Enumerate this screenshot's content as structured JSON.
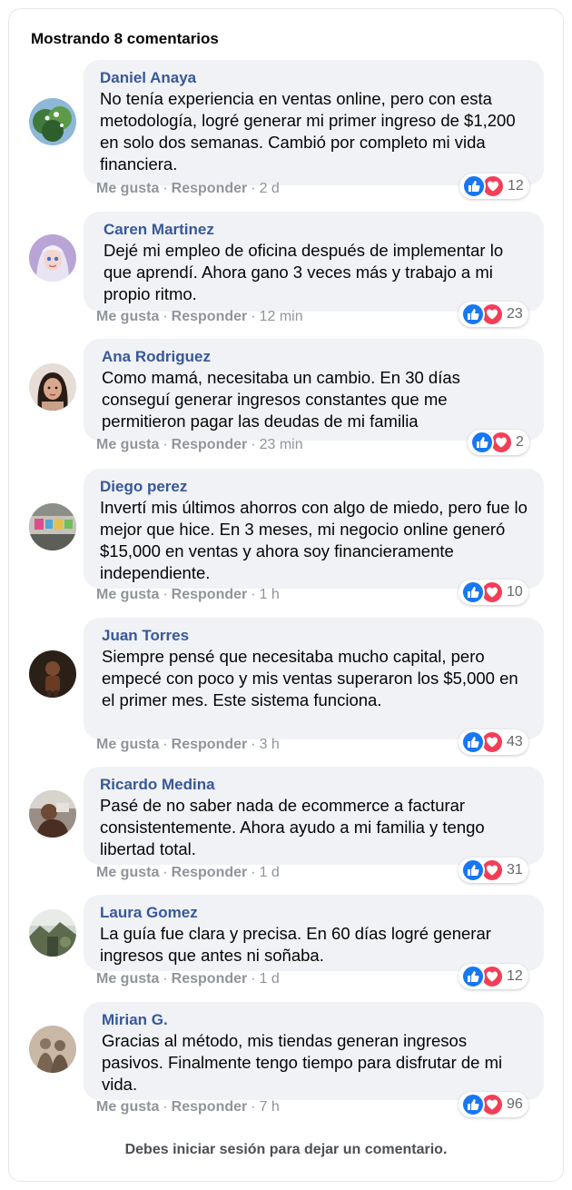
{
  "header": {
    "title": "Mostrando 8 comentarios"
  },
  "actions": {
    "like": "Me gusta",
    "reply": "Responder",
    "separator": "·"
  },
  "comments": [
    {
      "author": "Daniel Anaya",
      "text": "No tenía experiencia en ventas online, pero con esta metodología, logré generar mi primer ingreso de $1,200 en solo dos semanas. Cambió por completo mi vida financiera.",
      "time": "2 d",
      "reactions": "12",
      "avatar_icon": "nature-photo-avatar"
    },
    {
      "author": "Caren Martinez",
      "text": "Dejé mi empleo de oficina después de implementar lo que aprendí. Ahora gano 3 veces más y trabajo a mi propio ritmo.",
      "time": "12 min",
      "reactions": "23",
      "avatar_icon": "cartoon-character-avatar"
    },
    {
      "author": "Ana Rodriguez",
      "text": "Como mamá, necesitaba un cambio. En 30 días conseguí generar ingresos constantes que me permitieron pagar las deudas de mi familia",
      "time": "23 min",
      "reactions": "2",
      "avatar_icon": "woman-portrait-avatar"
    },
    {
      "author": "Diego perez",
      "text": "Invertí mis últimos ahorros con algo de miedo, pero fue lo mejor que hice. En 3 meses, mi negocio online generó $15,000 en ventas y ahora soy financieramente independiente.",
      "time": "1 h",
      "reactions": "10",
      "avatar_icon": "street-graffiti-avatar"
    },
    {
      "author": "Juan Torres",
      "text": "Siempre pensé que necesitaba mucho capital, pero empecé con poco y mis ventas superaron los $5,000 en el primer mes. Este sistema funciona.",
      "time": "3 h",
      "reactions": "43",
      "avatar_icon": "man-dark-photo-avatar"
    },
    {
      "author": "Ricardo Medina",
      "text": "Pasé de no saber nada de ecommerce a facturar consistentemente. Ahora ayudo a mi familia y tengo libertad total.",
      "time": "1 d",
      "reactions": "31",
      "avatar_icon": "man-photo-avatar"
    },
    {
      "author": "Laura Gomez",
      "text": "La guía fue clara y precisa. En 60 días logré generar ingresos que antes ni soñaba.",
      "time": "1 d",
      "reactions": "12",
      "avatar_icon": "outdoor-photo-avatar"
    },
    {
      "author": "Mirian G.",
      "text": "Gracias al método, mis tiendas generan ingresos pasivos. Finalmente tengo tiempo para disfrutar de mi vida.",
      "time": "7 h",
      "reactions": "96",
      "avatar_icon": "sepia-people-avatar"
    }
  ],
  "footer": {
    "text": "Debes iniciar sesión para dejar un comentario."
  },
  "colors": {
    "author": "#385898",
    "bubble": "#f0f2f5",
    "like": "#1877f2",
    "love": "#f33e58",
    "meta": "#90949c"
  }
}
